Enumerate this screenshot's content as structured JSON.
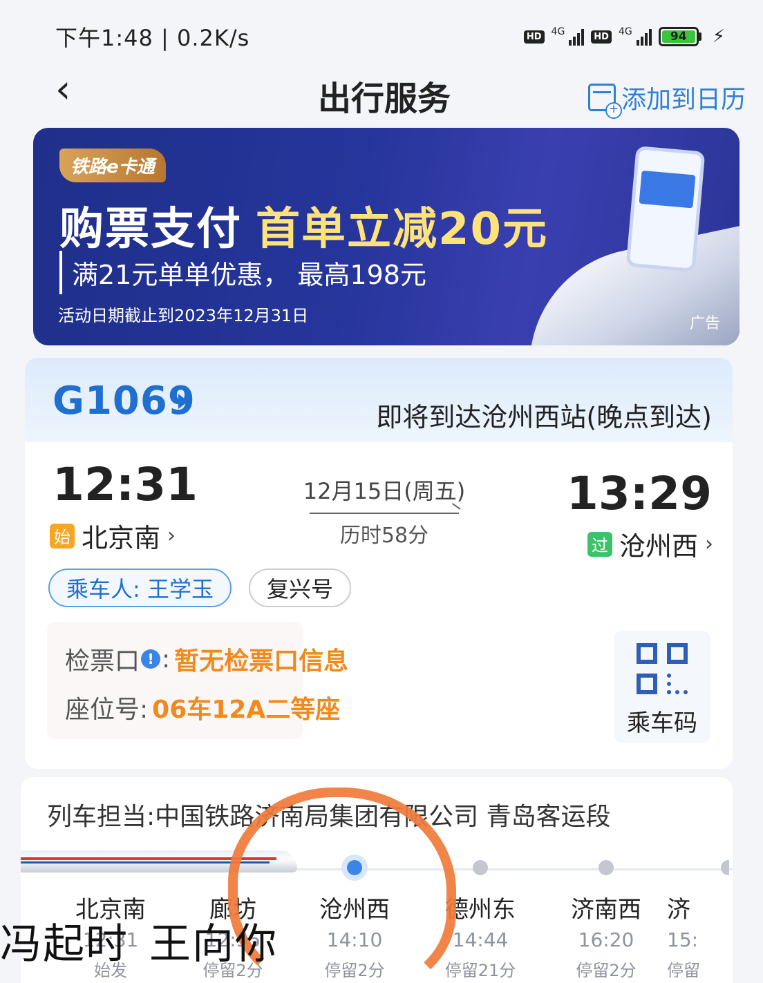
{
  "status_bar": {
    "time": "下午1:48 | 0.2K/s",
    "net1": "4G",
    "net2": "4G",
    "hd": "HD",
    "battery": "94"
  },
  "nav": {
    "title": "出行服务",
    "calendar_label": "添加到日历"
  },
  "banner": {
    "logo": "铁路e卡通",
    "headline_white": "购票支付",
    "headline_yellow": "首单立减20元",
    "sub": "满21元单单优惠， 最高198元",
    "date": "活动日期截止到2023年12月31日",
    "ad_tag": "广告"
  },
  "trip": {
    "train_no": "G1069",
    "status": "即将到达沧州西站(晚点到达)",
    "dep_time": "12:31",
    "dep_tag": "始",
    "dep_station": "北京南",
    "arr_time": "13:29",
    "arr_tag": "过",
    "arr_station": "沧州西",
    "date": "12月15日(周五)",
    "duration": "历时58分",
    "passenger": "乘车人: 王学玉",
    "train_type": "复兴号",
    "gate_label": "检票口",
    "gate_value": "暂无检票口信息",
    "seat_label": "座位号:",
    "seat_value": "06车12A二等座",
    "qr_label": "乘车码"
  },
  "route": {
    "operator": "列车担当:中国铁路济南局集团有限公司 青岛客运段",
    "stops": [
      {
        "name": "北京南",
        "time": "12:31",
        "dwell": "始发"
      },
      {
        "name": "廊坊",
        "time": "12:55",
        "dwell": "停留2分"
      },
      {
        "name": "沧州西",
        "time": "14:10",
        "dwell": "停留2分"
      },
      {
        "name": "德州东",
        "time": "14:44",
        "dwell": "停留21分"
      },
      {
        "name": "济南西",
        "time": "16:20",
        "dwell": "停留2分"
      },
      {
        "name": "济",
        "time": "15:",
        "dwell": "停留"
      }
    ]
  },
  "handwriting": {
    "text1": "冯起时",
    "text2": "王向你"
  },
  "colors": {
    "accent_blue": "#1f6fd0",
    "orange": "#f08a1c",
    "annotation_orange": "#f07a3a"
  }
}
